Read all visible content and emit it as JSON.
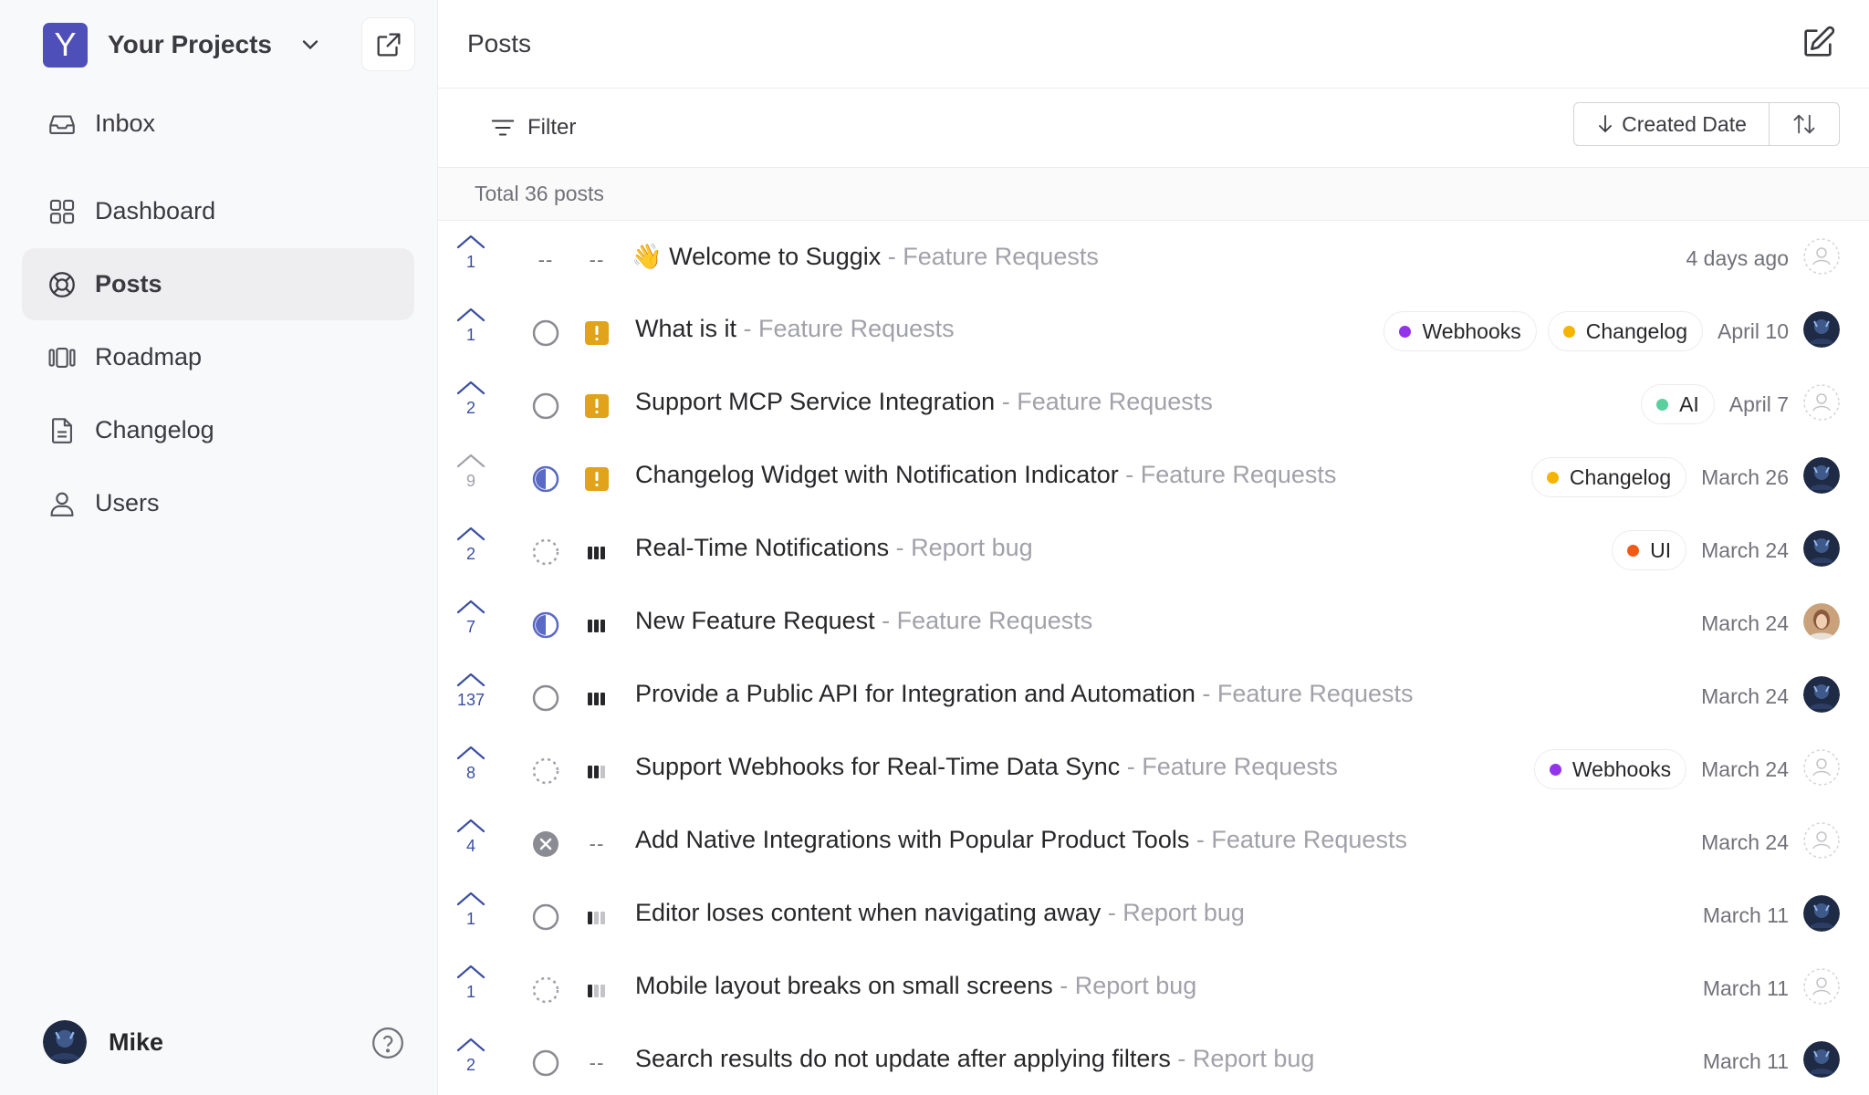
{
  "sidebar": {
    "project_initial": "Y",
    "project_name": "Your Projects",
    "items": [
      {
        "label": "Inbox",
        "icon": "inbox-icon"
      },
      {
        "label": "Dashboard",
        "icon": "dashboard-icon"
      },
      {
        "label": "Posts",
        "icon": "lifebuoy-icon"
      },
      {
        "label": "Roadmap",
        "icon": "roadmap-icon"
      },
      {
        "label": "Changelog",
        "icon": "document-icon"
      },
      {
        "label": "Users",
        "icon": "user-icon"
      }
    ],
    "active": "Posts",
    "user_name": "Mike"
  },
  "header": {
    "title": "Posts"
  },
  "toolbar": {
    "filter_label": "Filter",
    "sort_label": "Created Date"
  },
  "summary": {
    "total_text": "Total 36 posts"
  },
  "colors": {
    "accent": "#4e4fb8",
    "priority_high": "#e0a31a",
    "tag_purple": "#9333ea",
    "tag_yellow": "#f5b400",
    "tag_green": "#5ccf9f",
    "tag_orange": "#f05a14"
  },
  "posts": [
    {
      "votes": "1",
      "title": "👋 Welcome to Suggix",
      "board": " - Feature Requests",
      "date": "4 days ago",
      "tags": []
    },
    {
      "votes": "1",
      "title": "What is it",
      "board": " - Feature Requests",
      "date": "April 10",
      "tags": [
        "Webhooks",
        "Changelog"
      ]
    },
    {
      "votes": "2",
      "title": "Support MCP Service Integration",
      "board": " - Feature Requests",
      "date": "April 7",
      "tags": [
        "AI"
      ]
    },
    {
      "votes": "9",
      "title": "Changelog Widget with Notification Indicator",
      "board": " - Feature Requests",
      "date": "March 26",
      "tags": [
        "Changelog"
      ]
    },
    {
      "votes": "2",
      "title": "Real-Time Notifications",
      "board": " - Report bug",
      "date": "March 24",
      "tags": [
        "UI"
      ]
    },
    {
      "votes": "7",
      "title": "New Feature Request",
      "board": " - Feature Requests",
      "date": "March 24",
      "tags": []
    },
    {
      "votes": "137",
      "title": "Provide a Public API for Integration and Automation",
      "board": " - Feature Requests",
      "date": "March 24",
      "tags": []
    },
    {
      "votes": "8",
      "title": "Support Webhooks for Real-Time Data Sync",
      "board": " - Feature Requests",
      "date": "March 24",
      "tags": [
        "Webhooks"
      ]
    },
    {
      "votes": "4",
      "title": "Add Native Integrations with Popular Product Tools",
      "board": " - Feature Requests",
      "date": "March 24",
      "tags": []
    },
    {
      "votes": "1",
      "title": "Editor loses content when navigating away",
      "board": " - Report bug",
      "date": "March 11",
      "tags": []
    },
    {
      "votes": "1",
      "title": "Mobile layout breaks on small screens",
      "board": " - Report bug",
      "date": "March 11",
      "tags": []
    },
    {
      "votes": "2",
      "title": "Search results do not update after applying filters",
      "board": " - Report bug",
      "date": "March 11",
      "tags": []
    }
  ],
  "placeholder": "--"
}
